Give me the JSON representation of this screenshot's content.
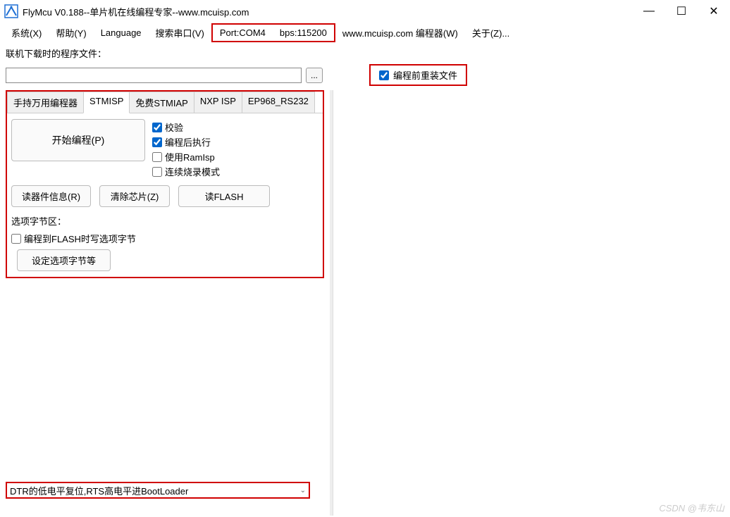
{
  "window": {
    "title": "FlyMcu V0.188--单片机在线编程专家--www.mcuisp.com"
  },
  "titlebar_controls": {
    "minimize": "—",
    "maximize": "☐",
    "close": "✕"
  },
  "menu": {
    "system": "系统(X)",
    "help": "帮助(Y)",
    "language": "Language",
    "search_port": "搜索串口(V)",
    "port": "Port:COM4",
    "bps": "bps:115200",
    "programmer": "www.mcuisp.com 编程器(W)",
    "about": "关于(Z)..."
  },
  "file_row": {
    "label": "联机下载时的程序文件：",
    "path": "",
    "browse": "...",
    "reload_checked": true,
    "reload_label": "编程前重装文件"
  },
  "tabs": {
    "t1": "手持万用编程器",
    "t2": "STMISP",
    "t3": "免费STMIAP",
    "t4": "NXP ISP",
    "t5": "EP968_RS232"
  },
  "stmisp": {
    "start_btn": "开始编程(P)",
    "verify": "校验",
    "verify_checked": true,
    "run_after": "编程后执行",
    "run_after_checked": true,
    "use_ramisp": "使用RamIsp",
    "use_ramisp_checked": false,
    "continuous": "连续烧录模式",
    "continuous_checked": false,
    "read_info": "读器件信息(R)",
    "erase": "清除芯片(Z)",
    "read_flash": "读FLASH",
    "option_section_label": "选项字节区：",
    "write_option": "编程到FLASH时写选项字节",
    "write_option_checked": false,
    "set_option_btn": "设定选项字节等"
  },
  "bottom": {
    "dropdown_value": "DTR的低电平复位,RTS高电平进BootLoader"
  },
  "watermark": "CSDN @韦东山"
}
